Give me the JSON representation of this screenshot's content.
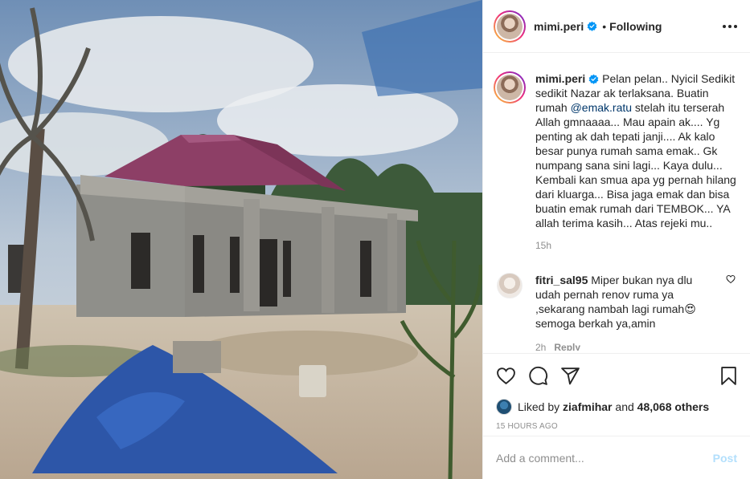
{
  "post": {
    "photo_alt": "",
    "author": "mimi.peri",
    "separator": "•",
    "follow_status": "Following",
    "colors": {
      "accent": "#0095f6",
      "mention": "#00376b",
      "muted": "#8e8e8e",
      "post_disabled": "#b2dffc"
    }
  },
  "caption": {
    "username": "mimi.peri",
    "text_before": " Pelan pelan.. Nyicil Sedikit sedikit Nazar ak terlaksana. Buatin rumah ",
    "mention": "@emak.ratu",
    "text_after": " stelah itu terserah Allah gmnaaaa... Mau apain ak.... Yg penting ak dah tepati janji.... Ak kalo besar punya rumah sama emak.. Gk numpang sana sini lagi... Kaya dulu... Kembali kan smua apa yg pernah hilang dari kluarga... Bisa jaga emak dan bisa buatin emak rumah dari TEMBOK... YA allah terima kasih... Atas rejeki mu..",
    "time": "15h"
  },
  "comment": {
    "username": "fitri_sal95",
    "text": " Miper bukan nya dlu udah pernah renov ruma ya ,sekarang nambah lagi rumah😍 semoga berkah ya,amin",
    "time": "2h",
    "reply_label": "Reply"
  },
  "actions": {
    "icons": [
      "heart-icon",
      "comment-icon",
      "share-icon",
      "bookmark-icon"
    ]
  },
  "likes": {
    "prefix": "Liked by ",
    "liker": "ziafmihar",
    "middle": " and ",
    "count": "48,068 others"
  },
  "timestamp": "15 HOURS AGO",
  "add_comment": {
    "placeholder": "Add a comment...",
    "post_label": "Post"
  }
}
